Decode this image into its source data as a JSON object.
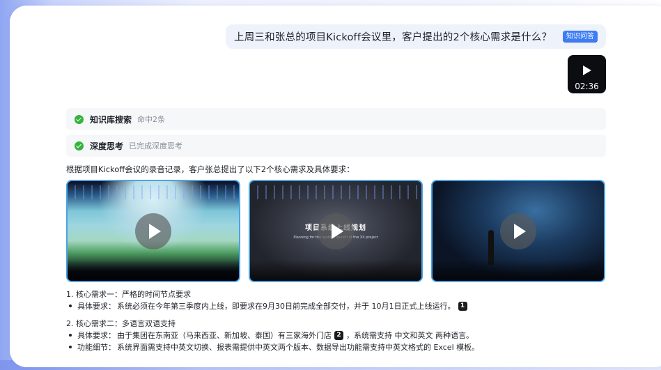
{
  "question": {
    "text": "上周三和张总的项目Kickoff会议里，客户提出的2个核心需求是什么？",
    "tag": "知识问答"
  },
  "attachment": {
    "duration": "02:36",
    "icon": "play-icon"
  },
  "steps": [
    {
      "title": "知识库搜索",
      "subtitle": "命中2条",
      "status_color": "#34b43c"
    },
    {
      "title": "深度思考",
      "subtitle": "已完成深度思考",
      "status_color": "#34b43c"
    }
  ],
  "answer": {
    "intro": "根据项目Kickoff会议的录音记录，客户张总提出了以下2个核心需求及具体要求：",
    "clips": [
      {
        "scene": "stage-landscape",
        "icon": "play-icon"
      },
      {
        "scene": "presentation-slide",
        "slide_title": "项目系统上线规划",
        "slide_subtitle": "Planning for the system launch of the XX project",
        "icon": "play-icon"
      },
      {
        "scene": "speaker-on-stage",
        "icon": "play-icon"
      }
    ],
    "requirements": [
      {
        "title": "1. 核心需求一：严格的时间节点要求",
        "bullets": [
          {
            "label": "具体要求：",
            "text": "系统必须在今年第三季度内上线，即要求在9月30日前完成全部交付，并于 10月1日正式上线运行。",
            "ref": "1"
          }
        ]
      },
      {
        "title": "2. 核心需求二：多语言双语支持",
        "bullets": [
          {
            "label": "具体要求：",
            "text_before": "由于集团在东南亚（马来西亚、新加坡、泰国）有三家海外门店",
            "ref": "2",
            "text_after": "，系统需支持 中文和英文 两种语言。"
          },
          {
            "label": "功能细节：",
            "text": "系统界面需支持中英文切换、报表需提供中英文两个版本、数据导出功能需支持中英文格式的 Excel 模板。"
          }
        ]
      }
    ]
  },
  "colors": {
    "accent": "#3c7cf4",
    "success": "#34b43c",
    "clip_border": "#4aa4e6"
  }
}
